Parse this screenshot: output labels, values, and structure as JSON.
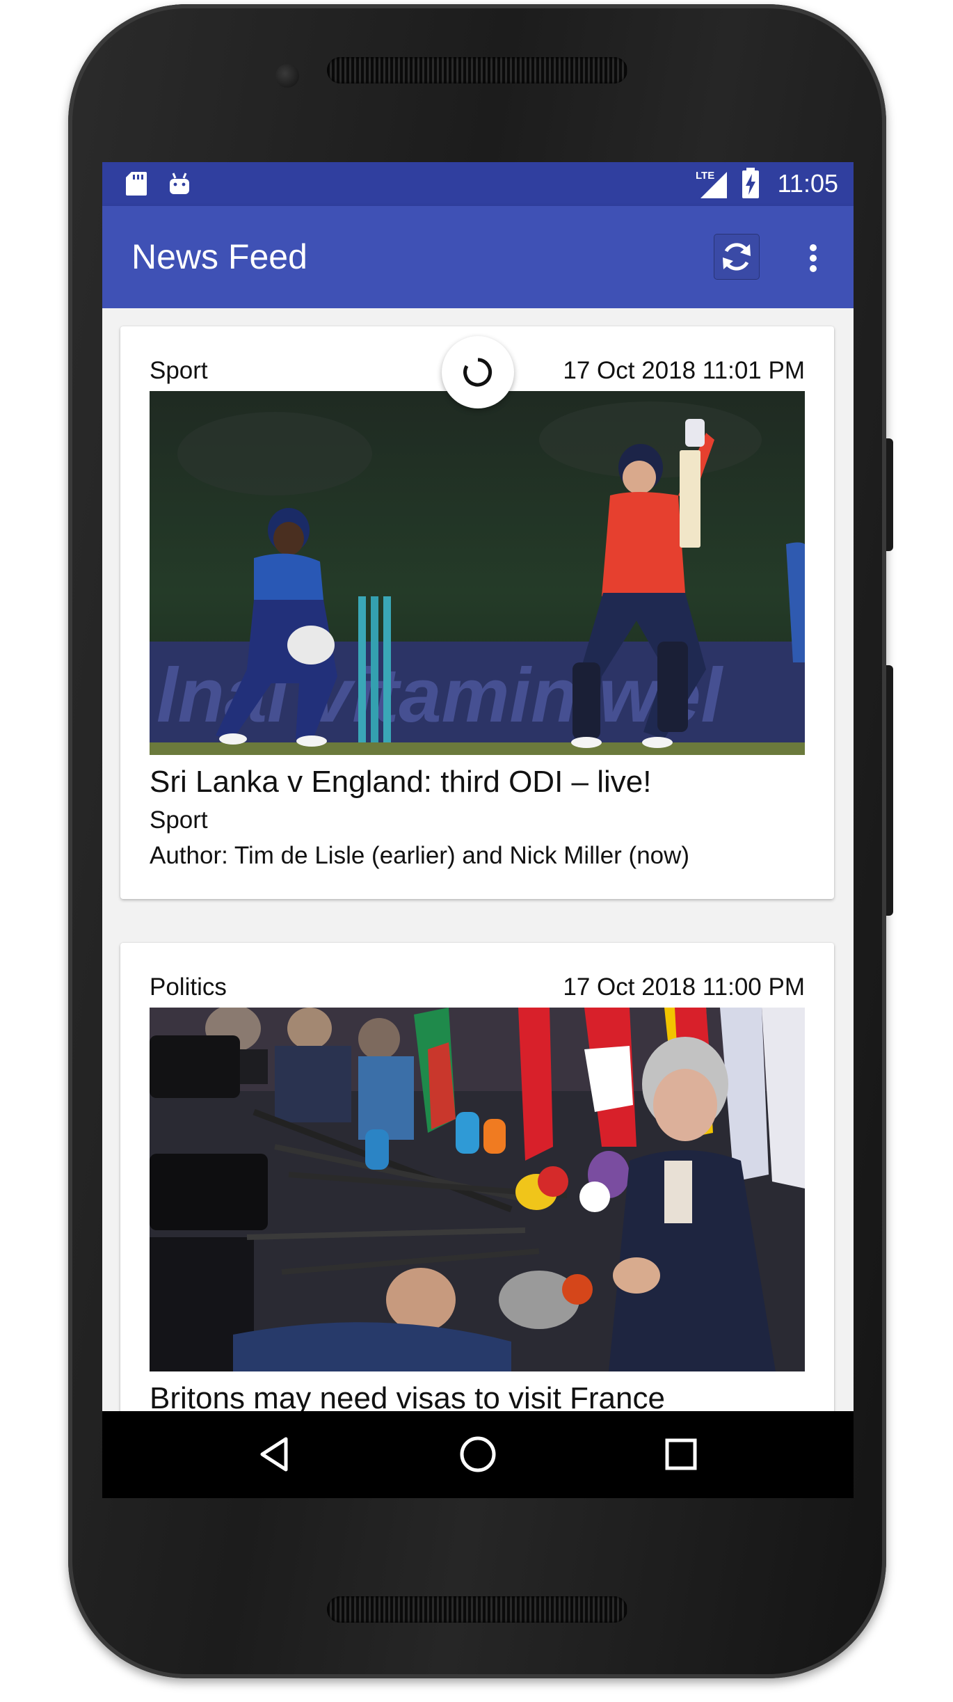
{
  "status_bar": {
    "time": "11:05",
    "network": "LTE",
    "left_icons": [
      "sd-card-icon",
      "android-icon"
    ],
    "right_icons": [
      "lte-signal-icon",
      "battery-charging-icon"
    ]
  },
  "app_bar": {
    "title": "News Feed",
    "actions": [
      "refresh-icon",
      "overflow-menu-icon"
    ]
  },
  "loading": true,
  "articles": [
    {
      "section": "Sport",
      "date": "17 Oct 2018 11:01 PM",
      "image": "cricket-photo",
      "title": "Sri Lanka v England: third ODI – live!",
      "category": "Sport",
      "author": "Author: Tim de Lisle (earlier) and Nick Miller (now)"
    },
    {
      "section": "Politics",
      "date": "17 Oct 2018 11:00 PM",
      "image": "press-conference-photo",
      "title": "Britons may need visas to visit France"
    }
  ],
  "nav_bar": {
    "buttons": [
      "back-icon",
      "home-icon",
      "recents-icon"
    ]
  },
  "colors": {
    "primary": "#3f51b5",
    "primary_dark": "#303f9f",
    "card_bg": "#ffffff",
    "list_bg": "#f2f2f2"
  }
}
